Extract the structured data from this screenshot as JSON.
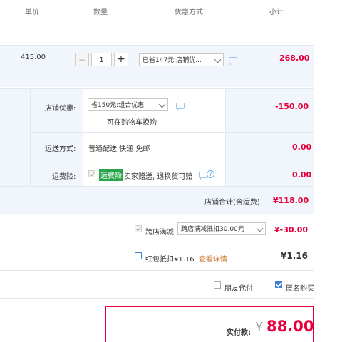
{
  "header": {
    "unit_price": "单价",
    "quantity": "数量",
    "discount_method": "优惠方式",
    "subtotal": "小计"
  },
  "item": {
    "price": "415.00",
    "quantity": "1",
    "minus": "−",
    "plus": "+",
    "discount_select": "已省147元:店铺优...",
    "subtotal": "268.00"
  },
  "shop": {
    "discount_label": "店铺优惠:",
    "discount_select": "省150元:组合优惠",
    "discount_note": "可在购物车换购",
    "discount_amount": "-150.00",
    "shipping_label": "运送方式:",
    "shipping_value": "普通配送 快递 免邮",
    "shipping_amount": "0.00",
    "insurance_label": "运费险:",
    "insurance_tag": "运费险",
    "insurance_desc": "卖家赠送, 退换货可赔",
    "insurance_amount": "0.00",
    "total_label": "店铺合计(含运费)",
    "total_value": "¥118.00"
  },
  "cross_store": {
    "label": "跨店满减",
    "select": "跨店满减抵扣30.00元",
    "amount": "¥-30.00"
  },
  "red_packet": {
    "label": "红包抵扣¥1.16",
    "link": "查看详情",
    "amount": "¥1.16"
  },
  "options": {
    "pay_for_friend": "朋友代付",
    "anonymous": "匿名购买"
  },
  "payment": {
    "label": "实付款:",
    "currency": "¥",
    "amount": "88.00"
  },
  "colors": {
    "accent_red": "#e4003a",
    "light_blue_bg": "#f1f6fd",
    "link_orange": "#c9762b",
    "green_tag": "#2aa44a"
  }
}
